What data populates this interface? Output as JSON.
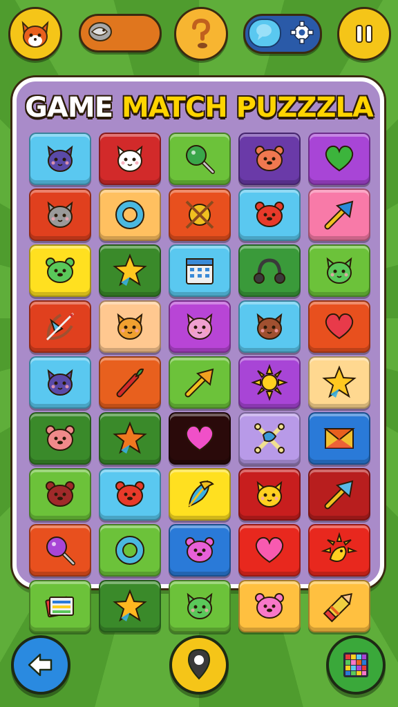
{
  "title": {
    "part1": "GAME ",
    "part2": "MATCH PUZZZLA"
  },
  "topbar": {
    "avatar_icon": "fox-avatar-icon",
    "coin_icon": "fish-coin-icon",
    "help_icon": "question-mark-icon",
    "toggle_icon": "speech-bubble-icon",
    "settings_icon": "gear-icon",
    "pause_icon": "pause-icon"
  },
  "colors": {
    "accent": "#ffd400",
    "board": "#a98bc9",
    "background": "#5fae3a"
  },
  "grid": [
    [
      {
        "icon": "cat-face",
        "bg": "#5ac8f0",
        "fg": "#5a4aa8"
      },
      {
        "icon": "cat-face",
        "bg": "#d22a2a",
        "fg": "#ffffff"
      },
      {
        "icon": "magnifier",
        "bg": "#6cc23a",
        "fg": "#3aa64a"
      },
      {
        "icon": "bear-face",
        "bg": "#6a3aa8",
        "fg": "#f07850"
      },
      {
        "icon": "heart",
        "bg": "#a845d6",
        "fg": "#3cb43c"
      }
    ],
    [
      {
        "icon": "cat-face",
        "bg": "#e0401e",
        "fg": "#9a9a9a"
      },
      {
        "icon": "ring",
        "bg": "#ffc060",
        "fg": "#4ab8e0"
      },
      {
        "icon": "orb-cross",
        "bg": "#e8501e",
        "fg": "#f0c020"
      },
      {
        "icon": "bear-face",
        "bg": "#5ac8f0",
        "fg": "#e83a2a"
      },
      {
        "icon": "arrow",
        "bg": "#f87aa8",
        "fg": "#2a8ad8"
      }
    ],
    [
      {
        "icon": "bear-face",
        "bg": "#ffe020",
        "fg": "#5ac85a"
      },
      {
        "icon": "star",
        "bg": "#3a8a2a",
        "fg": "#ffc820"
      },
      {
        "icon": "calendar",
        "bg": "#5ac8f0",
        "fg": "#f0f0f0"
      },
      {
        "icon": "headphones",
        "bg": "#3a9a3a",
        "fg": "#3a3a3a"
      },
      {
        "icon": "cat-face",
        "bg": "#6cc23a",
        "fg": "#5ac85a"
      }
    ],
    [
      {
        "icon": "bow",
        "bg": "#e0401e",
        "fg": "#5ab8e0"
      },
      {
        "icon": "cat-face",
        "bg": "#ffc890",
        "fg": "#f0a030"
      },
      {
        "icon": "cat-face",
        "bg": "#b845d6",
        "fg": "#f0a0d0"
      },
      {
        "icon": "cat-face",
        "bg": "#5ac8f0",
        "fg": "#a05030"
      },
      {
        "icon": "heart",
        "bg": "#e8501e",
        "fg": "#e83a4a"
      }
    ],
    [
      {
        "icon": "cat-face",
        "bg": "#5ac8f0",
        "fg": "#5a4aa8"
      },
      {
        "icon": "torch",
        "bg": "#e8601e",
        "fg": "#d22a2a"
      },
      {
        "icon": "arrow",
        "bg": "#6cc23a",
        "fg": "#f0a020"
      },
      {
        "icon": "sun",
        "bg": "#a845d6",
        "fg": "#ffd020"
      },
      {
        "icon": "star",
        "bg": "#ffd890",
        "fg": "#ffc820"
      }
    ],
    [
      {
        "icon": "bear-face",
        "bg": "#3a8a2a",
        "fg": "#f08a8a"
      },
      {
        "icon": "star",
        "bg": "#3a8a2a",
        "fg": "#f07820"
      },
      {
        "icon": "heart",
        "bg": "#2a0a0a",
        "fg": "#f050c8"
      },
      {
        "icon": "crossed-bones",
        "bg": "#b89ae8",
        "fg": "#3a9ad8"
      },
      {
        "icon": "envelope",
        "bg": "#2a7ad8",
        "fg": "#f0c030"
      }
    ],
    [
      {
        "icon": "bear-face",
        "bg": "#6cc23a",
        "fg": "#a02a2a"
      },
      {
        "icon": "bear-face",
        "bg": "#5ac8f0",
        "fg": "#e83a2a"
      },
      {
        "icon": "feather",
        "bg": "#ffe020",
        "fg": "#3ab0e0"
      },
      {
        "icon": "cat-face",
        "bg": "#c81e1e",
        "fg": "#ffd020"
      },
      {
        "icon": "arrow",
        "bg": "#b81e1e",
        "fg": "#5ab8e8"
      }
    ],
    [
      {
        "icon": "magnifier",
        "bg": "#e8501e",
        "fg": "#a845d6"
      },
      {
        "icon": "ring",
        "bg": "#6cc23a",
        "fg": "#4ab8e0"
      },
      {
        "icon": "bear-face",
        "bg": "#2a7ad8",
        "fg": "#e860d8"
      },
      {
        "icon": "heart",
        "bg": "#e8281e",
        "fg": "#f85ab0"
      },
      {
        "icon": "sun-bird",
        "bg": "#e8281e",
        "fg": "#ffd020"
      }
    ],
    [
      {
        "icon": "cards",
        "bg": "#6cc23a",
        "fg": "#f0f0f0"
      },
      {
        "icon": "star",
        "bg": "#3a8a2a",
        "fg": "#ffb820"
      },
      {
        "icon": "cat-face",
        "bg": "#6cc23a",
        "fg": "#5ac85a"
      },
      {
        "icon": "bear-face",
        "bg": "#ffc040",
        "fg": "#f878c8"
      },
      {
        "icon": "crayon",
        "bg": "#ffc040",
        "fg": "#f0d040"
      }
    ]
  ],
  "bottombar": {
    "back_icon": "back-arrow-icon",
    "map_icon": "map-pin-icon",
    "grid_icon": "grid-icon"
  }
}
